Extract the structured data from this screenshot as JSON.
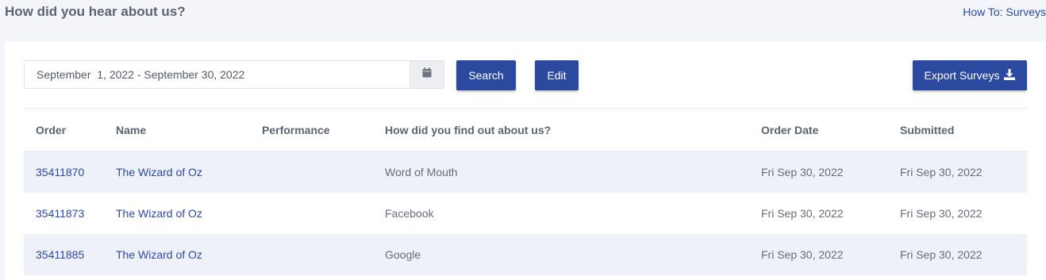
{
  "header": {
    "title": "How did you hear about us?",
    "howto_link": "How To: Surveys"
  },
  "toolbar": {
    "date_range_value": "September  1, 2022 - September 30, 2022",
    "calendar_icon": "calendar-icon",
    "search_label": "Search",
    "edit_label": "Edit",
    "export_label": "Export Surveys",
    "export_icon": "download-icon",
    "accent_color": "#2c49a0"
  },
  "table": {
    "columns": [
      "Order",
      "Name",
      "Performance",
      "How did you find out about us?",
      "Order Date",
      "Submitted"
    ],
    "rows": [
      {
        "order": "35411870",
        "name": "The Wizard of Oz",
        "performance": "",
        "source": "Word of Mouth",
        "order_date": "Fri Sep 30, 2022",
        "submitted": "Fri Sep 30, 2022"
      },
      {
        "order": "35411873",
        "name": "The Wizard of Oz",
        "performance": "",
        "source": "Facebook",
        "order_date": "Fri Sep 30, 2022",
        "submitted": "Fri Sep 30, 2022"
      },
      {
        "order": "35411885",
        "name": "The Wizard of Oz",
        "performance": "",
        "source": "Google",
        "order_date": "Fri Sep 30, 2022",
        "submitted": "Fri Sep 30, 2022"
      }
    ]
  }
}
